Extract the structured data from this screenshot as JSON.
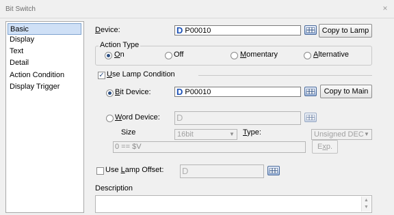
{
  "window": {
    "title": "Bit Switch",
    "close_glyph": "×"
  },
  "tabs": [
    {
      "label": "Basic",
      "selected": true
    },
    {
      "label": "Display"
    },
    {
      "label": "Text"
    },
    {
      "label": "Detail"
    },
    {
      "label": "Action Condition"
    },
    {
      "label": "Display Trigger"
    }
  ],
  "device": {
    "label_accel": "D",
    "label_rest": "evice:",
    "prefix": "D",
    "value": "P00010",
    "copy_button": "Copy to Lamp"
  },
  "action_type": {
    "title": "Action Type",
    "options": [
      {
        "accel": "O",
        "rest": "n",
        "checked": true
      },
      {
        "accel": "",
        "rest": "Off",
        "checked": false
      },
      {
        "accel": "M",
        "rest": "omentary",
        "checked": false
      },
      {
        "accel": "A",
        "rest": "lternative",
        "checked": false
      }
    ]
  },
  "lamp_condition": {
    "checked": true,
    "accel": "U",
    "rest": "se Lamp Condition",
    "bit_device": {
      "accel": "B",
      "rest": "it Device:",
      "prefix": "D",
      "value": "P00010",
      "copy_button": "Copy to Main",
      "checked": true
    },
    "word_device": {
      "accel": "W",
      "rest": "ord Device:",
      "prefix": "D",
      "value": "",
      "checked": false
    },
    "size_label": "Size",
    "size_value": "16bit",
    "type_accel": "T",
    "type_rest": "ype:",
    "type_value": "Unsigned DEC",
    "expression": "0 == $V",
    "exp_button_accel": "x",
    "exp_button_pre": "E",
    "exp_button_post": "p."
  },
  "lamp_offset": {
    "checked": false,
    "pre": "Use ",
    "accel": "L",
    "rest": "amp Offset:",
    "prefix": "D"
  },
  "description": {
    "label": "Description",
    "value": ""
  },
  "colors": {
    "accent": "#1a4fb4",
    "selection": "#cfe0f6"
  },
  "icons": [
    "close-icon",
    "device-browse-icon",
    "radio-icon",
    "checkbox-icon",
    "dropdown-arrow-icon",
    "scroll-up-icon",
    "scroll-down-icon"
  ]
}
